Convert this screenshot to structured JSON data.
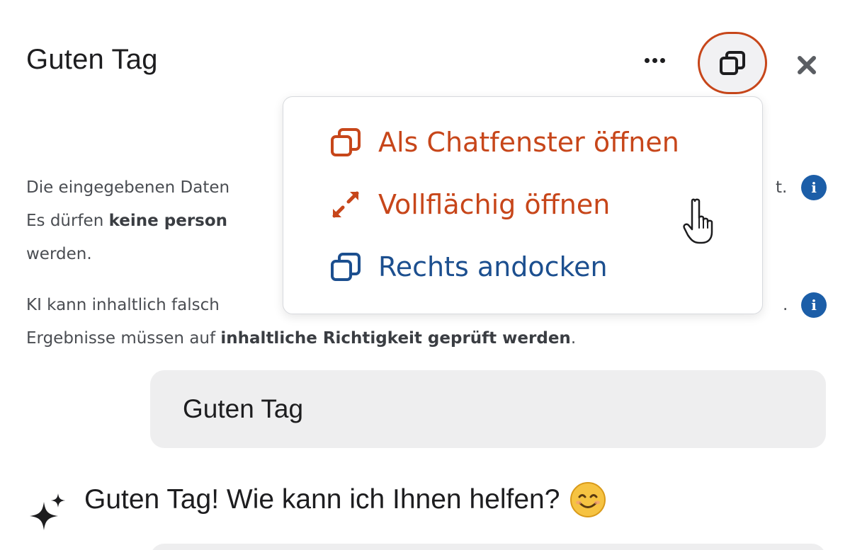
{
  "header": {
    "title": "Guten Tag",
    "more_icon": "ellipsis-icon",
    "window_icon": "window-restore-icon",
    "close_icon": "close-icon"
  },
  "notices": [
    {
      "line1": "Die eingegebenen Daten",
      "line1_end": "t.",
      "line2_prefix": "Es dürfen ",
      "line2_bold": "keine person",
      "line3": "werden.",
      "icon": "info-icon"
    },
    {
      "line1": "KI kann inhaltlich falsch",
      "line1_end": ".",
      "line2_prefix": "Ergebnisse müssen auf ",
      "line2_bold": "inhaltliche Richtigkeit geprüft werden",
      "line2_suffix": ".",
      "icon": "info-icon"
    }
  ],
  "chat": {
    "user_message": "Guten Tag",
    "bot_message": "Guten Tag! Wie kann ich Ihnen helfen?",
    "bot_icon": "sparkle-icon",
    "emoji_icon": "smiling-face-icon"
  },
  "menu": {
    "items": [
      {
        "label": "Als Chatfenster öffnen",
        "icon": "window-restore-icon",
        "color": "#c7461a"
      },
      {
        "label": "Vollflächig öffnen",
        "icon": "expand-arrows-icon",
        "color": "#c7461a"
      },
      {
        "label": "Rechts andocken",
        "icon": "window-restore-icon",
        "color": "#1c4f8f"
      }
    ]
  },
  "colors": {
    "accent_orange": "#c7461a",
    "accent_blue": "#1c4f8f",
    "info_blue": "#1c5ea8",
    "bubble_gray": "#eeeeef"
  }
}
